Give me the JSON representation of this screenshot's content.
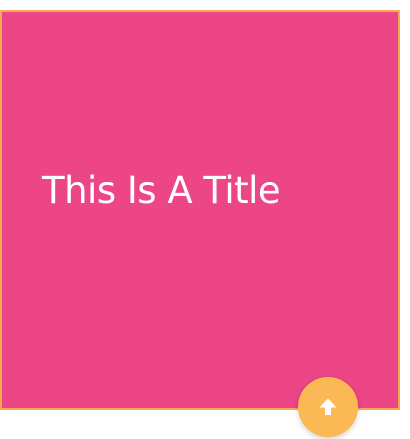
{
  "card": {
    "title": "This Is A Title",
    "background_color": "#ec4687",
    "border_color": "#f5a951"
  },
  "fab": {
    "icon": "arrow-up-icon",
    "background_color": "#fbb855",
    "icon_color": "#ffffff"
  }
}
